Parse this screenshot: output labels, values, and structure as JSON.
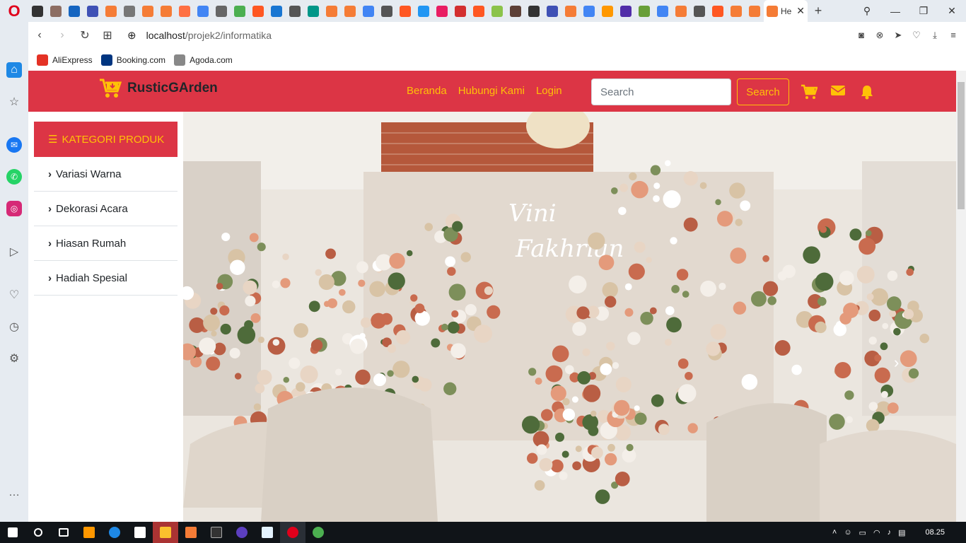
{
  "browser": {
    "active_tab_title": "He",
    "url_host": "localhost",
    "url_path": "/projek2/informatika",
    "bookmarks": [
      {
        "label": "AliExpress",
        "color": "#e43225"
      },
      {
        "label": "Booking.com",
        "color": "#003580"
      },
      {
        "label": "Agoda.com",
        "color": "#888888"
      }
    ]
  },
  "site": {
    "brand": "RusticGArden",
    "nav": [
      "Beranda",
      "Hubungi Kami",
      "Login"
    ],
    "search_placeholder": "Search",
    "search_button": "Search",
    "colors": {
      "primary": "#dc3545",
      "accent": "#ffc107"
    }
  },
  "categories": {
    "title": "KATEGORI PRODUK",
    "items": [
      "Variasi Warna",
      "Dekorasi Acara",
      "Hiasan Rumah",
      "Hadiah Spesial"
    ]
  },
  "hero": {
    "sign_line1": "Vini",
    "sign_line2": "Fakhrian"
  },
  "taskbar": {
    "time": "08.25"
  }
}
